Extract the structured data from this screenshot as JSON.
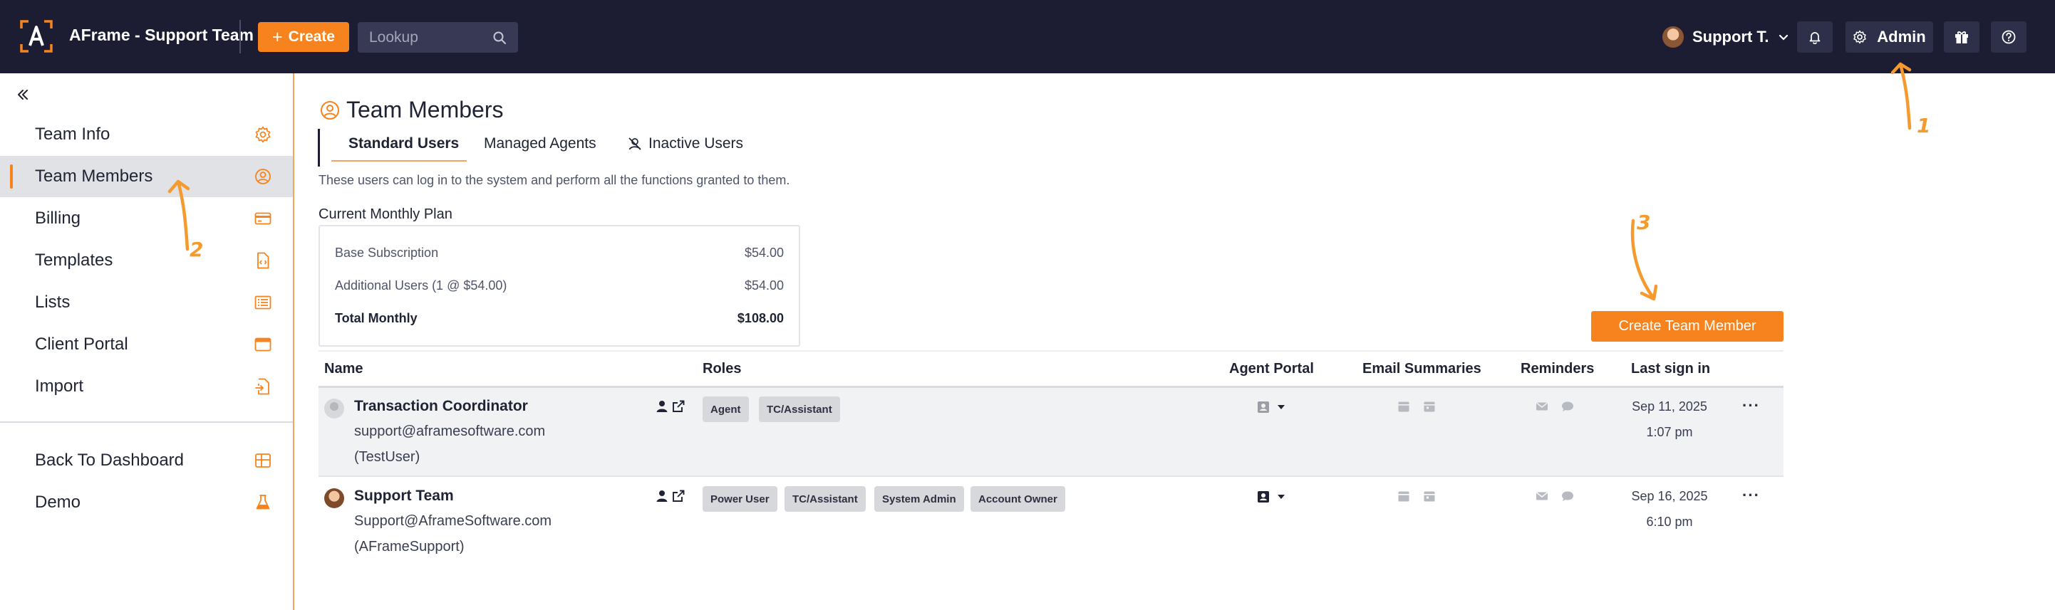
{
  "topbar": {
    "app_title": "AFrame - Support Team",
    "create_label": "Create",
    "lookup_placeholder": "Lookup",
    "user_label": "Support T.",
    "admin_label": "Admin"
  },
  "sidebar": {
    "items": [
      {
        "label": "Team Info",
        "icon": "gear-icon"
      },
      {
        "label": "Team Members",
        "icon": "user-circle-icon",
        "active": true
      },
      {
        "label": "Billing",
        "icon": "credit-card-icon"
      },
      {
        "label": "Templates",
        "icon": "document-code-icon"
      },
      {
        "label": "Lists",
        "icon": "list-icon"
      },
      {
        "label": "Client Portal",
        "icon": "browser-window-icon"
      },
      {
        "label": "Import",
        "icon": "file-import-icon"
      }
    ],
    "bottom_items": [
      {
        "label": "Back To Dashboard",
        "icon": "grid-icon"
      },
      {
        "label": "Demo",
        "icon": "flask-icon"
      }
    ]
  },
  "main": {
    "title": "Team Members",
    "tabs": [
      {
        "label": "Standard Users",
        "active": true
      },
      {
        "label": "Managed Agents"
      },
      {
        "label": "Inactive Users",
        "icon": "user-slash-icon"
      }
    ],
    "description": "These users can log in to the system and perform all the functions granted to them.",
    "plan": {
      "title": "Current Monthly Plan",
      "rows": [
        {
          "label": "Base Subscription",
          "value": "$54.00"
        },
        {
          "label": "Additional Users (1 @ $54.00)",
          "value": "$54.00"
        },
        {
          "label": "Total Monthly",
          "value": "$108.00"
        }
      ]
    },
    "create_member_label": "Create Team Member",
    "table": {
      "headers": {
        "name": "Name",
        "roles": "Roles",
        "agent_portal": "Agent Portal",
        "email_summaries": "Email Summaries",
        "reminders": "Reminders",
        "last_sign_in": "Last sign in"
      },
      "rows": [
        {
          "name": "Transaction Coordinator",
          "email": "support@aframesoftware.com",
          "username": "(TestUser)",
          "roles": [
            "Agent",
            "TC/Assistant"
          ],
          "last_date": "Sep 11, 2025",
          "last_time": "1:07 pm"
        },
        {
          "name": "Support Team",
          "email": "Support@AframeSoftware.com",
          "username": "(AFrameSupport)",
          "roles": [
            "Power User",
            "TC/Assistant",
            "System Admin",
            "Account Owner"
          ],
          "last_date": "Sep 16, 2025",
          "last_time": "6:10 pm"
        }
      ]
    }
  },
  "annotations": [
    "1",
    "2",
    "3"
  ],
  "colors": {
    "brand_orange": "#f7831e",
    "topbar_bg": "#1c1d33",
    "annotation": "#f59a2c"
  }
}
